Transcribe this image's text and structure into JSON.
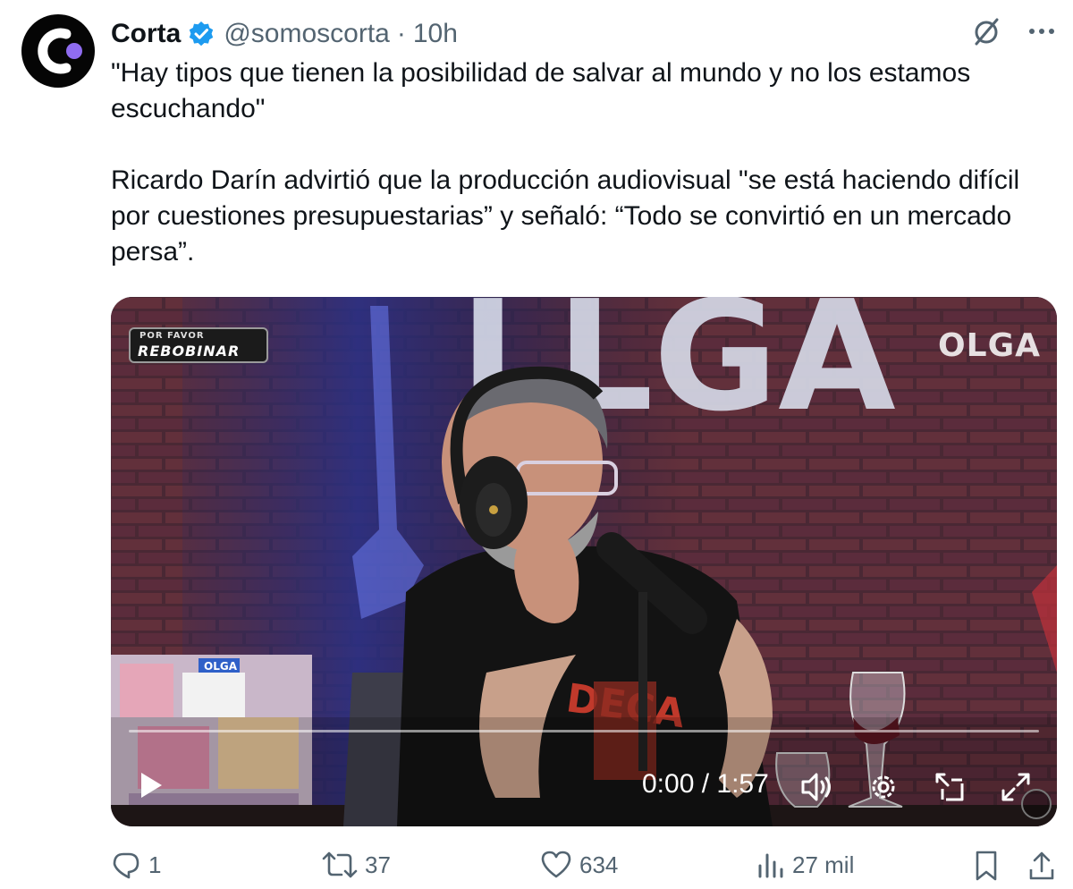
{
  "tweet": {
    "author_name": "Corta",
    "handle": "@somoscorta",
    "separator": "·",
    "time": "10h",
    "paragraphs": [
      "\"Hay tipos que tienen la posibilidad de salvar al mundo y no los estamos escuchando\"",
      "Ricardo Darín advirtió que la producción audiovisual \"se está haciendo difícil por cuestiones presupuestarias” y señaló: “Todo se convirtió en un mercado persa”."
    ]
  },
  "video": {
    "overlay_logo_line1": "POR FAVOR",
    "overlay_logo_line2": "REBOBINAR",
    "watermark": "OLGA",
    "sign_letters": "LLGA",
    "sticker_text": "OLGA",
    "shirt_text": "DECA",
    "current_time": "0:00",
    "time_separator": " / ",
    "duration": "1:57",
    "progress": 0
  },
  "actions": {
    "replies": "1",
    "reposts": "37",
    "likes": "634",
    "views": "27 mil"
  },
  "icons": [
    "verified-badge-icon",
    "grok-icon",
    "more-icon",
    "play-icon",
    "volume-icon",
    "settings-icon",
    "pip-icon",
    "fullscreen-icon",
    "reply-icon",
    "repost-icon",
    "like-icon",
    "views-icon",
    "bookmark-icon",
    "share-icon"
  ],
  "colors": {
    "text": "#0f1419",
    "secondary": "#536471",
    "verified": "#1d9bf0",
    "avatar_accent": "#8f6cf0"
  }
}
